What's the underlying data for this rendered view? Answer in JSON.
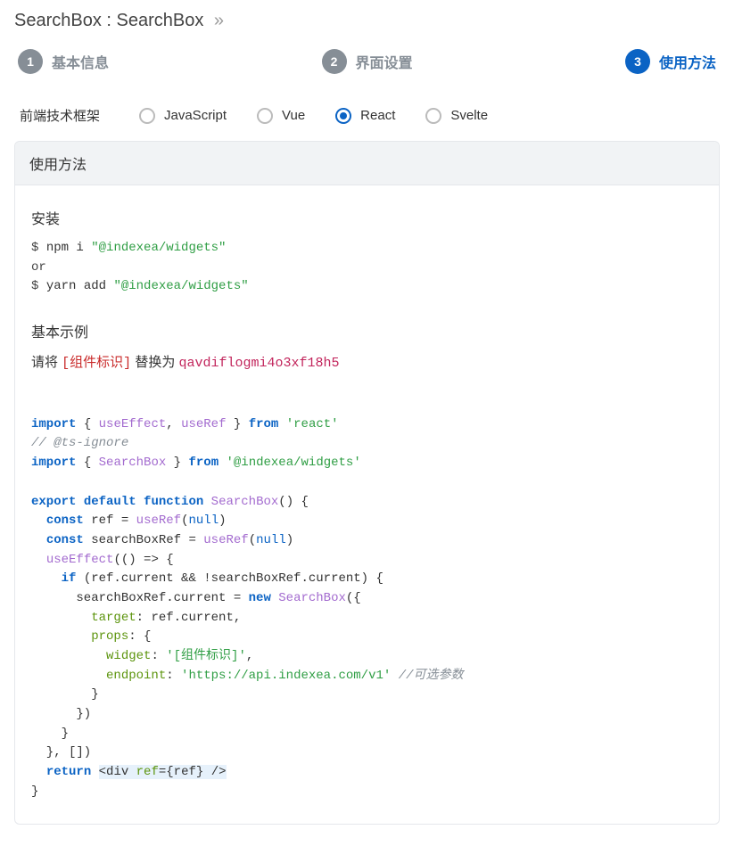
{
  "breadcrumb": {
    "title": "SearchBox : SearchBox",
    "chevron": "»"
  },
  "steps": {
    "s1": {
      "num": "1",
      "label": "基本信息"
    },
    "s2": {
      "num": "2",
      "label": "界面设置"
    },
    "s3": {
      "num": "3",
      "label": "使用方法"
    }
  },
  "frameworkLabel": "前端技术框架",
  "frameworks": {
    "js": "JavaScript",
    "vue": "Vue",
    "react": "React",
    "svelte": "Svelte"
  },
  "card": {
    "header": "使用方法",
    "installTitle": "安装",
    "install": {
      "p1": "$ ",
      "l1a": "npm i ",
      "l1b": "\"@indexea/widgets\"",
      "orText": "or",
      "p2": "$ ",
      "l2a": "yarn add ",
      "l2b": "\"@indexea/widgets\""
    },
    "exampleTitle": "基本示例",
    "replace": {
      "pre": "请将 ",
      "placeholder": "[组件标识]",
      "mid": " 替换为 ",
      "value": "qavdiflogmi4o3xf18h5"
    },
    "code": {
      "kw_import": "import",
      "kw_from": "from",
      "kw_export": "export",
      "kw_default": "default",
      "kw_function": "function",
      "kw_const": "const",
      "kw_if": "if",
      "kw_new": "new",
      "kw_return": "return",
      "kw_null": "null",
      "useEffect": "useEffect",
      "useRef": "useRef",
      "SearchBox": "SearchBox",
      "react_mod": "'react'",
      "widgets_mod": "'@indexea/widgets'",
      "ts_ignore": "// @ts-ignore",
      "ref_name": "ref",
      "sbref_name": "searchBoxRef",
      "prop_target": "target",
      "prop_props": "props",
      "prop_widget": "widget",
      "prop_endpoint": "endpoint",
      "widget_val": "'[组件标识]'",
      "endpoint_val": "'https://api.indexea.com/v1'",
      "opt_comment": "//可选参数",
      "div_open": "<div ",
      "div_close": " />"
    }
  }
}
